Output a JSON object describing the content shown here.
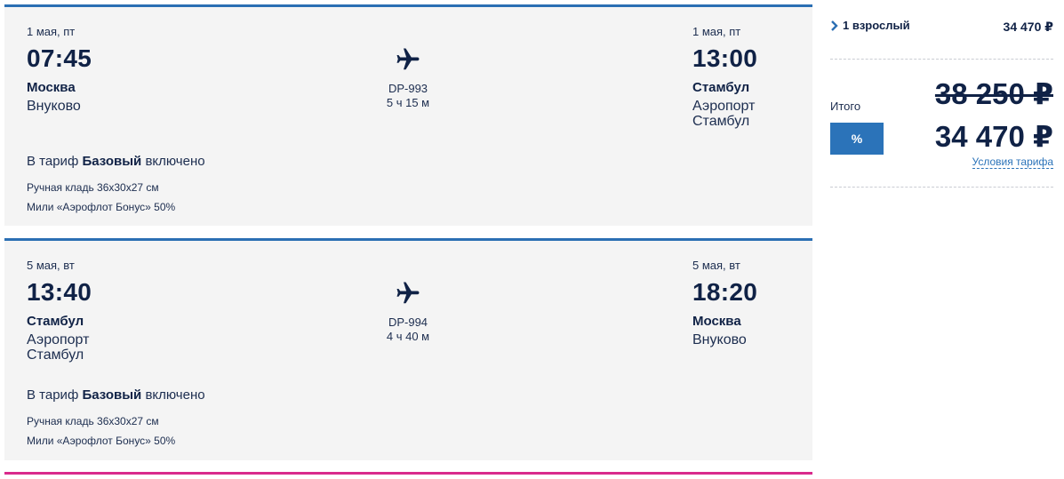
{
  "segments": [
    {
      "dep_date": "1 мая, пт",
      "dep_time": "07:45",
      "dep_city": "Москва",
      "dep_airport": "Внуково",
      "flight_number": "DP-993",
      "duration": "5 ч 15 м",
      "arr_date": "1 мая, пт",
      "arr_time": "13:00",
      "arr_city": "Стамбул",
      "arr_airport": "Аэропорт Стамбул",
      "tariff_prefix": "В тариф",
      "tariff_name": "Базовый",
      "tariff_suffix": "включено",
      "features": [
        "Ручная кладь 36x30x27 см",
        "Мили «Аэрофлот Бонус» 50%"
      ]
    },
    {
      "dep_date": "5 мая, вт",
      "dep_time": "13:40",
      "dep_city": "Стамбул",
      "dep_airport": "Аэропорт Стамбул",
      "flight_number": "DP-994",
      "duration": "4 ч 40 м",
      "arr_date": "5 мая, вт",
      "arr_time": "18:20",
      "arr_city": "Москва",
      "arr_airport": "Внуково",
      "tariff_prefix": "В тариф",
      "tariff_name": "Базовый",
      "tariff_suffix": "включено",
      "features": [
        "Ручная кладь 36x30x27 см",
        "Мили «Аэрофлот Бонус» 50%"
      ]
    }
  ],
  "summary": {
    "passenger_label": "1 взрослый",
    "passenger_price": "34 470 ₽",
    "total_label": "Итого",
    "discount_label": "%",
    "old_price": "38 250 ₽",
    "new_price": "34 470 ₽",
    "tariff_link": "Условия тарифа"
  },
  "colors": {
    "accent_blue": "#2b6fb3",
    "text_navy": "#102246",
    "pink_line": "#d92a8c",
    "card_bg": "#f4f4f4"
  },
  "icons": {
    "plane": "airplane-icon",
    "chevron": "chevron-right-icon"
  }
}
